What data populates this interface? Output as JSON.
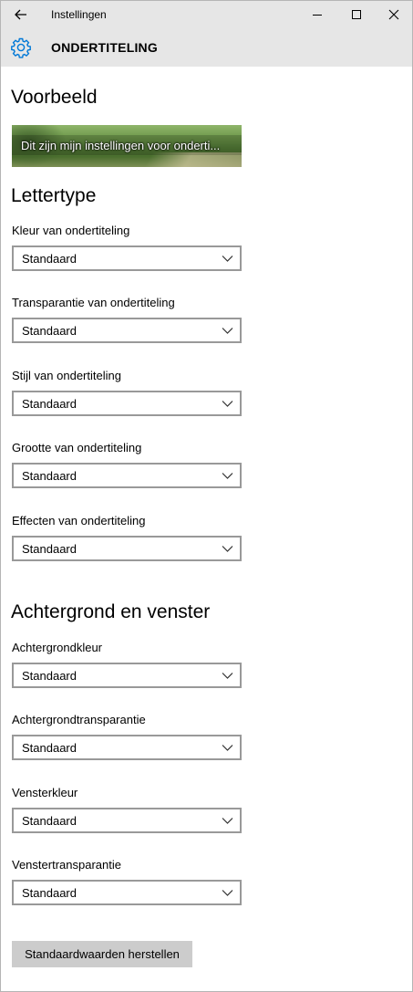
{
  "window": {
    "title": "Instellingen"
  },
  "header": {
    "icon": "gear-icon",
    "title": "ONDERTITELING"
  },
  "preview": {
    "heading": "Voorbeeld",
    "text": "Dit zijn mijn instellingen voor onderti..."
  },
  "font_section": {
    "heading": "Lettertype",
    "fields": [
      {
        "label": "Kleur van ondertiteling",
        "value": "Standaard"
      },
      {
        "label": "Transparantie van ondertiteling",
        "value": "Standaard"
      },
      {
        "label": "Stijl van ondertiteling",
        "value": "Standaard"
      },
      {
        "label": "Grootte van ondertiteling",
        "value": "Standaard"
      },
      {
        "label": "Effecten van ondertiteling",
        "value": "Standaard"
      }
    ]
  },
  "background_section": {
    "heading": "Achtergrond en venster",
    "fields": [
      {
        "label": "Achtergrondkleur",
        "value": "Standaard"
      },
      {
        "label": "Achtergrondtransparantie",
        "value": "Standaard"
      },
      {
        "label": "Vensterkleur",
        "value": "Standaard"
      },
      {
        "label": "Venstertransparantie",
        "value": "Standaard"
      }
    ]
  },
  "reset_button": {
    "label": "Standaardwaarden herstellen"
  },
  "colors": {
    "accent": "#0078d7",
    "titlebar": "#e6e6e6",
    "button": "#cccccc",
    "select_border": "#999999"
  }
}
